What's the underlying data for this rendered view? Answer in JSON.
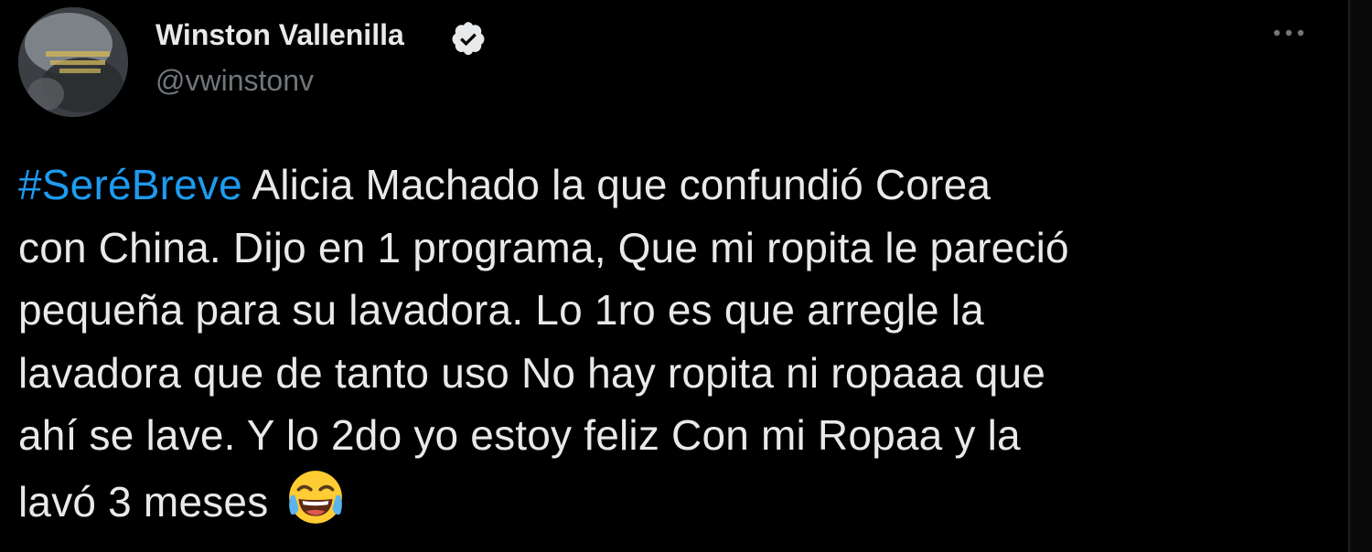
{
  "tweet": {
    "author_name": "Winston Vallenilla",
    "handle": "@vwinstonv",
    "verified": true,
    "hashtag": "#SeréBreve",
    "text_line_1": " Alicia Machado la que confundió Corea",
    "text_line_2": "con China. Dijo en 1 programa, Que mi ropita le pareció",
    "text_line_3": "pequeña para su lavadora. Lo 1ro es que arregle la",
    "text_line_4": "lavadora que de tanto uso No hay ropita ni ropaaa que",
    "text_line_5": "ahí se lave. Y lo 2do yo estoy feliz Con mi Ropaa y la",
    "text_line_6": "lavó 3 meses ",
    "emoji": "face-with-tears-of-joy-icon"
  },
  "colors": {
    "background": "#000000",
    "text": "#e7e9ea",
    "secondary": "#71767b",
    "link": "#1d9bf0"
  }
}
